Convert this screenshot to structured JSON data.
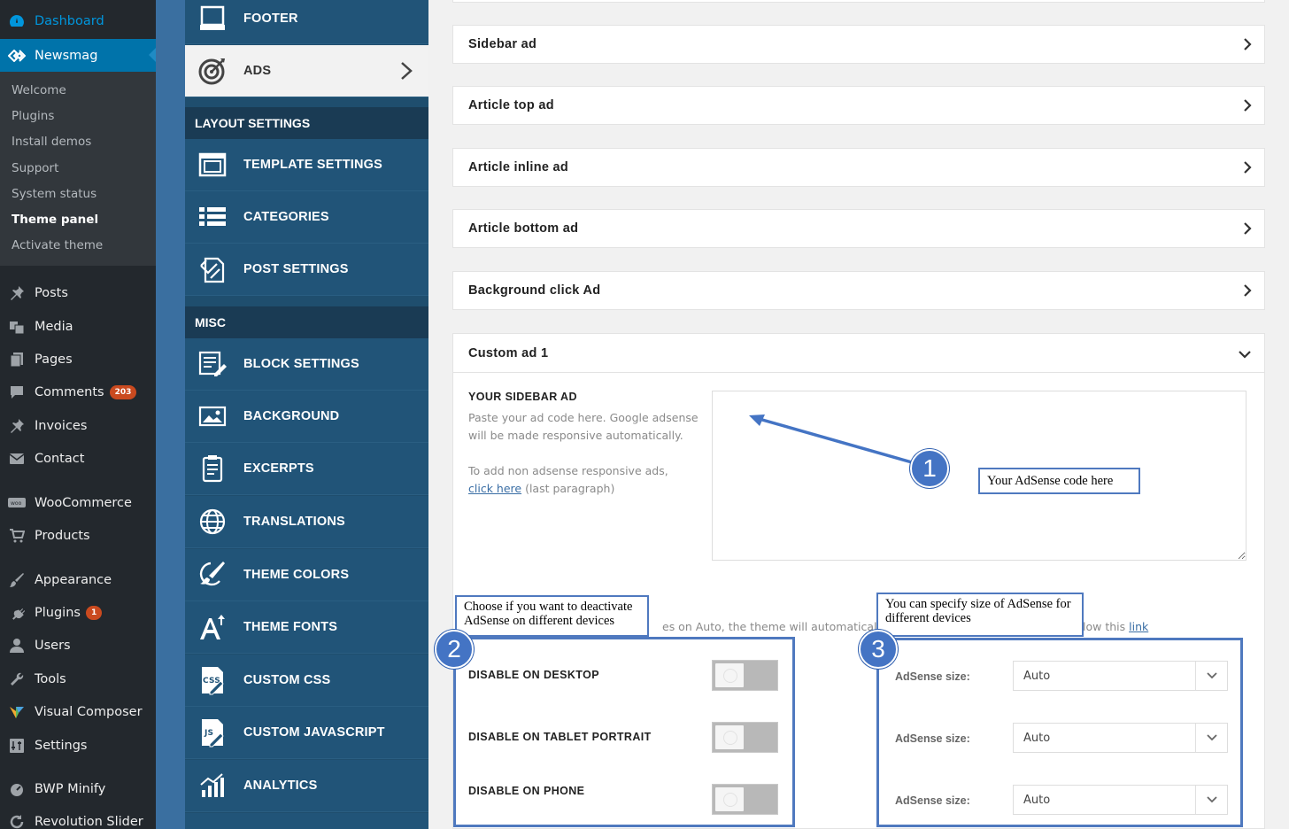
{
  "wp_menu": {
    "dashboard": "Dashboard",
    "newsmag": "Newsmag",
    "submenu": [
      "Welcome",
      "Plugins",
      "Install demos",
      "Support",
      "System status",
      "Theme panel",
      "Activate theme"
    ],
    "items": [
      {
        "label": "Posts",
        "icon": "pushpin-icon"
      },
      {
        "label": "Media",
        "icon": "media-icon"
      },
      {
        "label": "Pages",
        "icon": "pages-icon"
      },
      {
        "label": "Comments",
        "icon": "comments-icon",
        "badge": "203"
      },
      {
        "label": "Invoices",
        "icon": "pushpin-icon"
      },
      {
        "label": "Contact",
        "icon": "mail-icon"
      },
      {
        "label": "WooCommerce",
        "icon": "woo-icon"
      },
      {
        "label": "Products",
        "icon": "cart-icon"
      },
      {
        "label": "Appearance",
        "icon": "brush-icon"
      },
      {
        "label": "Plugins",
        "icon": "plugin-icon",
        "badge": "1"
      },
      {
        "label": "Users",
        "icon": "user-icon"
      },
      {
        "label": "Tools",
        "icon": "wrench-icon"
      },
      {
        "label": "Visual Composer",
        "icon": "vc-icon"
      },
      {
        "label": "Settings",
        "icon": "settings-icon"
      },
      {
        "label": "BWP Minify",
        "icon": "gauge-icon"
      },
      {
        "label": "Revolution Slider",
        "icon": "refresh-icon"
      }
    ]
  },
  "theme_nav": {
    "footer": "FOOTER",
    "ads": "ADS",
    "section_layout": "LAYOUT SETTINGS",
    "template_settings": "TEMPLATE SETTINGS",
    "categories": "CATEGORIES",
    "post_settings": "POST SETTINGS",
    "section_misc": "MISC",
    "block_settings": "BLOCK SETTINGS",
    "background": "BACKGROUND",
    "excerpts": "EXCERPTS",
    "translations": "TRANSLATIONS",
    "theme_colors": "THEME COLORS",
    "theme_fonts": "THEME FONTS",
    "custom_css": "CUSTOM CSS",
    "custom_javascript": "CUSTOM JAVASCRIPT",
    "analytics": "ANALYTICS"
  },
  "ads_panels": [
    "Sidebar ad",
    "Article top ad",
    "Article inline ad",
    "Article bottom ad",
    "Background click Ad"
  ],
  "custom_ad": {
    "title": "Custom ad 1",
    "field_title": "YOUR SIDEBAR AD",
    "hint1": "Paste your ad code here. Google adsense will be made responsive automatically.",
    "hint2_prefix": "To add non adsense responsive ads,",
    "hint2_link": "click here",
    "hint2_suffix": "(last paragraph)",
    "device_note_visible": "es on Auto, the theme will automatically re",
    "device_note_end": "low this",
    "device_note_link": "link",
    "toggles": [
      {
        "label": "DISABLE ON DESKTOP",
        "on": false
      },
      {
        "label": "DISABLE ON TABLET PORTRAIT",
        "on": false
      },
      {
        "label": "DISABLE ON PHONE",
        "on": false
      }
    ],
    "sizes": [
      {
        "label": "AdSense size:",
        "value": "Auto"
      },
      {
        "label": "AdSense size:",
        "value": "Auto"
      },
      {
        "label": "AdSense size:",
        "value": "Auto"
      }
    ]
  },
  "annotations": {
    "n1": "1",
    "n2": "2",
    "n3": "3",
    "note1": "Your AdSense code here",
    "note2": "Choose if you want to deactivate AdSense on different devices",
    "note3": "You can specify size of AdSense for different devices"
  },
  "colors": {
    "wp_sidebar": "#23282d",
    "wp_active": "#0073aa",
    "theme_nav": "#215478",
    "annotation_blue": "#4f79bf"
  }
}
